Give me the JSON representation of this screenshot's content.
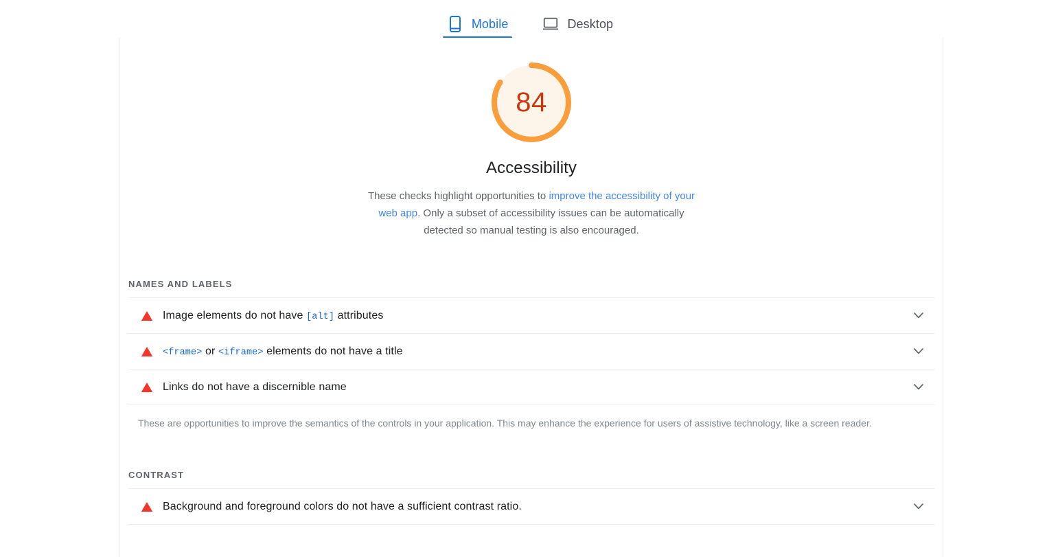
{
  "tabs": [
    {
      "id": "mobile",
      "label": "Mobile",
      "icon": "mobile-phone-icon",
      "active": true
    },
    {
      "id": "desktop",
      "label": "Desktop",
      "icon": "desktop-laptop-icon",
      "active": false
    }
  ],
  "score": {
    "value": "84",
    "category_title": "Accessibility",
    "ring_color": "#fa9e3b",
    "ring_track_color": "#fdf5ea",
    "value_color": "#c8380c",
    "percent": 84
  },
  "description": {
    "part1": "These checks highlight opportunities to ",
    "link1": "improve the accessibility of your web app",
    "part2": ". Only a subset of accessibility issues can be automatically detected so manual testing is also encouraged."
  },
  "sections": [
    {
      "id": "names-and-labels",
      "title": "NAMES AND LABELS",
      "audits": [
        {
          "id": "image-alt",
          "status": "fail",
          "status_icon": "warning-triangle-icon",
          "expand_icon": "chevron-down-icon",
          "title_parts": [
            {
              "type": "text",
              "value": "Image elements do not have "
            },
            {
              "type": "code",
              "value": "[alt]"
            },
            {
              "type": "text",
              "value": " attributes"
            }
          ]
        },
        {
          "id": "frame-title",
          "status": "fail",
          "status_icon": "warning-triangle-icon",
          "expand_icon": "chevron-down-icon",
          "title_parts": [
            {
              "type": "code",
              "value": "<frame>"
            },
            {
              "type": "text",
              "value": " or "
            },
            {
              "type": "code",
              "value": "<iframe>"
            },
            {
              "type": "text",
              "value": " elements do not have a title"
            }
          ]
        },
        {
          "id": "link-name",
          "status": "fail",
          "status_icon": "warning-triangle-icon",
          "expand_icon": "chevron-down-icon",
          "title_parts": [
            {
              "type": "text",
              "value": "Links do not have a discernible name"
            }
          ]
        }
      ],
      "note": "These are opportunities to improve the semantics of the controls in your application. This may enhance the experience for users of assistive technology, like a screen reader."
    },
    {
      "id": "contrast",
      "title": "CONTRAST",
      "audits": [
        {
          "id": "color-contrast",
          "status": "fail",
          "status_icon": "warning-triangle-icon",
          "expand_icon": "chevron-down-icon",
          "title_parts": [
            {
              "type": "text",
              "value": "Background and foreground colors do not have a sufficient contrast ratio."
            }
          ]
        }
      ],
      "note": ""
    }
  ],
  "colors": {
    "accent_blue": "#1a73e8",
    "fail_red": "#f4352b",
    "text_primary": "#202124",
    "text_secondary": "#5f6368"
  }
}
